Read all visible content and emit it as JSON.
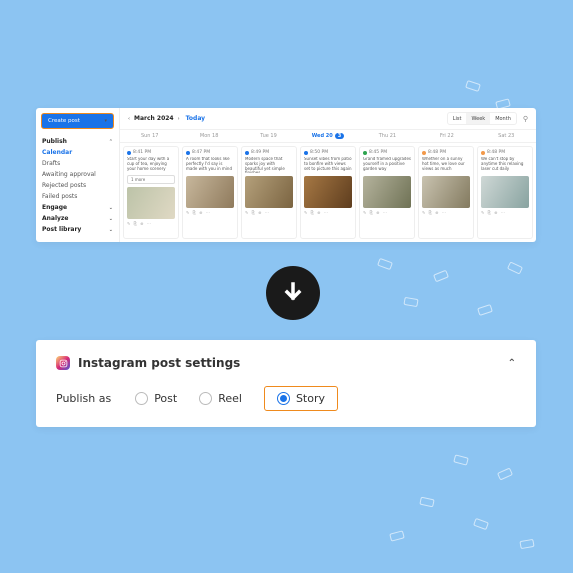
{
  "sidebar": {
    "create_label": "Create post",
    "items": [
      {
        "label": "Publish",
        "sec": true,
        "exp": true
      },
      {
        "label": "Calendar",
        "active": true
      },
      {
        "label": "Drafts"
      },
      {
        "label": "Awaiting approval"
      },
      {
        "label": "Rejected posts"
      },
      {
        "label": "Failed posts"
      },
      {
        "label": "Engage",
        "sec": true
      },
      {
        "label": "Analyze",
        "sec": true
      },
      {
        "label": "Post library",
        "sec": true
      }
    ]
  },
  "toolbar": {
    "month": "March 2024",
    "today_label": "Today",
    "views": [
      "List",
      "Week",
      "Month"
    ],
    "active_view": "Week"
  },
  "days": [
    {
      "label": "Sun 17"
    },
    {
      "label": "Mon 18"
    },
    {
      "label": "Tue 19"
    },
    {
      "label": "Wed 20",
      "hot": true,
      "badge": "3"
    },
    {
      "label": "Thu 21"
    },
    {
      "label": "Fri 22"
    },
    {
      "label": "Sat 23"
    }
  ],
  "posts": [
    {
      "time": "8:41 PM",
      "dot": "dblue",
      "text": "Start your day with a cup of tea, enjoying your home scenery",
      "img": "linear-gradient(120deg,#bcc3a8,#e0d9c4)",
      "pill": "1 more"
    },
    {
      "time": "8:47 PM",
      "dot": "dblue",
      "text": "A room that looks like perfectly I'd say is made with you in mind",
      "img": "linear-gradient(120deg,#c7b79c,#8f7a5c)"
    },
    {
      "time": "8:49 PM",
      "dot": "dblue",
      "text": "Modern space that sparks joy with beautiful yet simple finishes",
      "img": "linear-gradient(120deg,#b4a07b,#7b6441)"
    },
    {
      "time": "8:50 PM",
      "dot": "dblue",
      "text": "Sunset vibes from patio to bonfire with views set to picture this again",
      "img": "linear-gradient(120deg,#a67844,#5e3d1e)"
    },
    {
      "time": "8:45 PM",
      "dot": "dgreen",
      "text": "Grand framed upgrades yourself in a positive garden way",
      "img": "linear-gradient(120deg,#b5b39d,#6f7255)"
    },
    {
      "time": "8:48 PM",
      "dot": "dorange",
      "text": "Whether on a sunny hot time, we love our views as much",
      "img": "linear-gradient(120deg,#c9c3b0,#837a5f)"
    },
    {
      "time": "8:48 PM",
      "dot": "dorange",
      "text": "We can't stop by anytime this relaxing laser cut daily",
      "img": "linear-gradient(120deg,#cfd8d6,#88a3a0)"
    }
  ],
  "settings": {
    "title": "Instagram post settings",
    "publish_label": "Publish as",
    "options": [
      "Post",
      "Reel",
      "Story"
    ],
    "selected": "Story"
  }
}
